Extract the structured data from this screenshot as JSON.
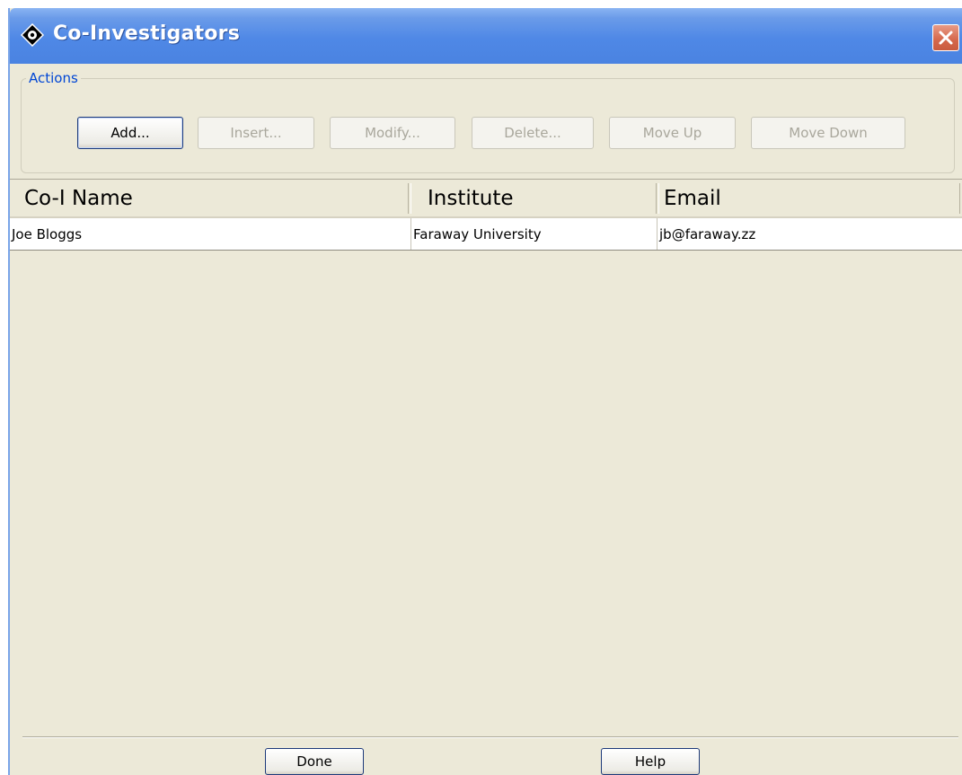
{
  "window": {
    "title": "Co-Investigators",
    "icon": "diamond-app-icon",
    "close_icon": "close-icon"
  },
  "actions": {
    "legend": "Actions",
    "buttons": [
      {
        "label": "Add...",
        "enabled": true
      },
      {
        "label": "Insert...",
        "enabled": false
      },
      {
        "label": "Modify...",
        "enabled": false
      },
      {
        "label": "Delete...",
        "enabled": false
      },
      {
        "label": "Move Up",
        "enabled": false
      },
      {
        "label": "Move Down",
        "enabled": false
      }
    ]
  },
  "table": {
    "columns": [
      "Co-I Name",
      "Institute",
      "Email"
    ],
    "rows": [
      [
        "Joe Bloggs",
        "Faraway University",
        "jb@faraway.zz"
      ]
    ]
  },
  "footer": {
    "done_label": "Done",
    "help_label": "Help"
  },
  "colors": {
    "titlebar": "#4f88e6",
    "dialog_bg": "#ece9d8",
    "legend_text": "#0046d5",
    "close_button": "#d5674b"
  }
}
